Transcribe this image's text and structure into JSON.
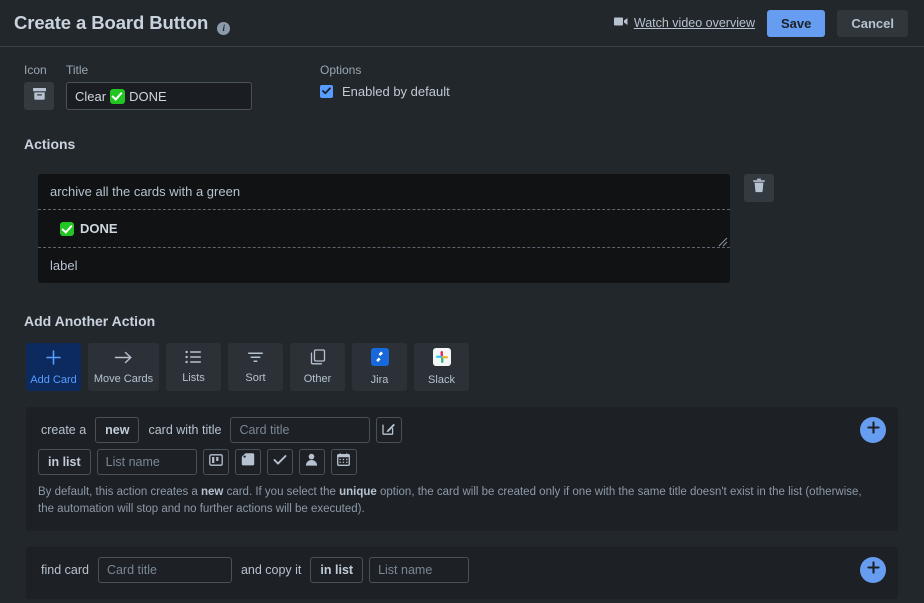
{
  "header": {
    "title": "Create a Board Button",
    "info_icon": "info-icon",
    "watch_video": "Watch video overview",
    "save_label": "Save",
    "cancel_label": "Cancel",
    "accent_blue": "#669df1"
  },
  "fields": {
    "icon_label": "Icon",
    "icon_glyph": "archive-box-icon",
    "title_label": "Title",
    "title_value_before": "Clear",
    "title_value_after": "DONE",
    "options_label": "Options",
    "enabled_label": "Enabled by default",
    "enabled_checked": true
  },
  "actions": {
    "section_title": "Actions",
    "lines": [
      {
        "text": "archive all the cards with a green",
        "style": "plain"
      },
      {
        "text": "DONE",
        "style": "emoji-bold"
      },
      {
        "text": "label",
        "style": "plain"
      }
    ],
    "delete_icon": "trash-icon"
  },
  "add_another": {
    "section_title": "Add Another Action",
    "tabs": [
      {
        "label": "Add Card",
        "icon": "plus-icon",
        "active": true,
        "wide": false
      },
      {
        "label": "Move Cards",
        "icon": "arrow-right-icon",
        "active": false,
        "wide": true
      },
      {
        "label": "Lists",
        "icon": "list-icon",
        "active": false,
        "wide": false
      },
      {
        "label": "Sort",
        "icon": "sort-icon",
        "active": false,
        "wide": false
      },
      {
        "label": "Other",
        "icon": "copy-icon",
        "active": false,
        "wide": false
      },
      {
        "label": "Jira",
        "icon": "jira-icon",
        "active": false,
        "wide": false
      },
      {
        "label": "Slack",
        "icon": "slack-icon",
        "active": false,
        "wide": false
      }
    ]
  },
  "panel_add_card": {
    "prefix": "create a",
    "chip_new": "new",
    "mid_text": "card with title",
    "card_title_placeholder": "Card title",
    "card_title_value": "",
    "edit_icon": "edit-pencil-icon",
    "in_list_chip": "in list",
    "list_name_placeholder": "List name",
    "list_name_value": "",
    "icons": [
      "board-icon",
      "label-tag-icon",
      "check-icon",
      "member-icon",
      "calendar-icon"
    ],
    "help_part1": "By default, this action creates a ",
    "help_bold1": "new",
    "help_part2": " card. If you select the ",
    "help_bold2": "unique",
    "help_part3": " option, the card will be created only if one with the same title doesn't exist in the list (otherwise, the automation will stop and no further actions will be executed).",
    "add_icon": "plus-icon"
  },
  "panel_find_card": {
    "prefix": "find card",
    "card_title_placeholder": "Card title",
    "card_title_value": "",
    "mid_text": "and copy it",
    "in_list_chip": "in list",
    "list_name_placeholder": "List name",
    "list_name_value": "",
    "add_icon": "plus-icon"
  }
}
